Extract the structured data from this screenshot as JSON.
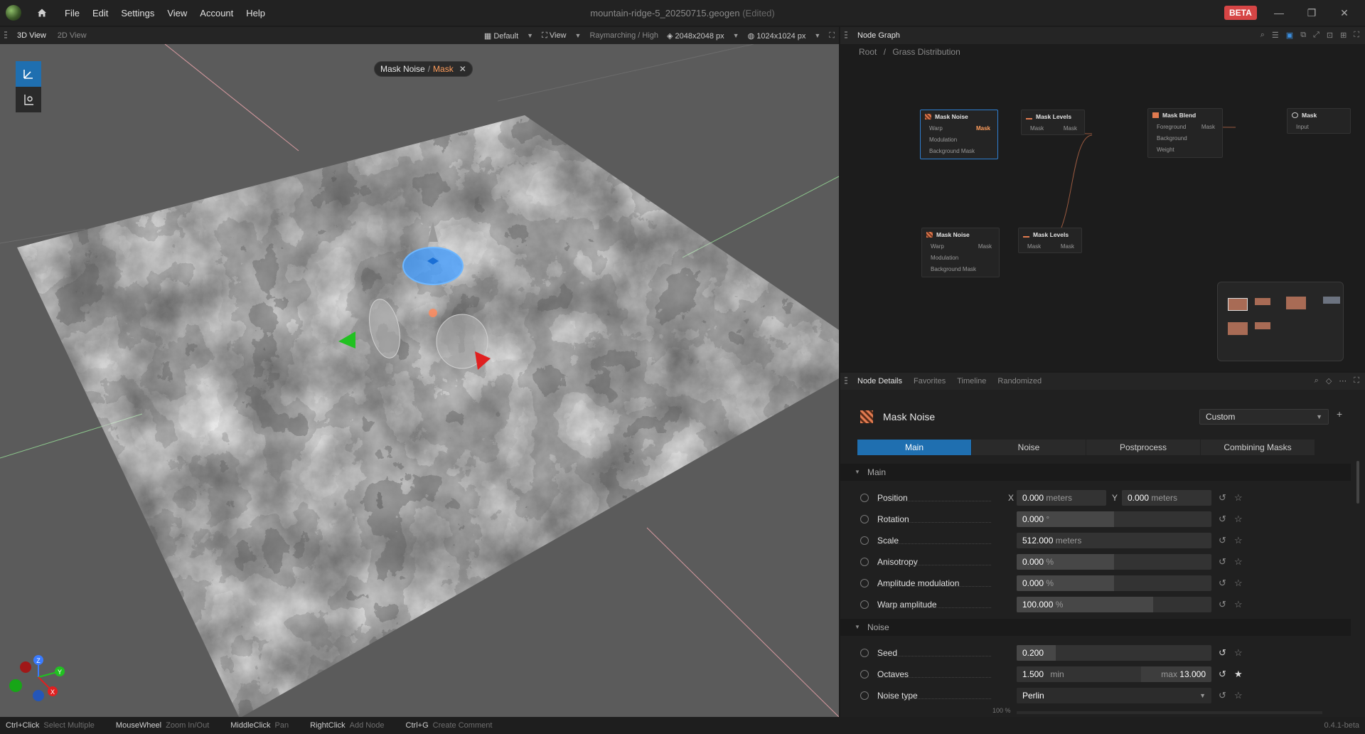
{
  "app": {
    "menu": [
      "File",
      "Edit",
      "Settings",
      "View",
      "Account",
      "Help"
    ],
    "title": "mountain-ridge-5_20250715.geogen",
    "title_status": "(Edited)",
    "badge": "BETA",
    "icons": {
      "logo": "globe-logo",
      "home": "home-icon",
      "minimize": "minimize-icon",
      "maximize": "restore-icon",
      "close": "close-icon"
    }
  },
  "viewport": {
    "tabs": [
      "3D View",
      "2D View"
    ],
    "toolbar": {
      "layout": "Default",
      "view": "View",
      "render_mode": "Raymarching / High",
      "resolution": "2048x2048 px",
      "preview_resolution": "1024x1024 px"
    },
    "breadcrumb": {
      "node": "Mask Noise",
      "separator": "/",
      "output": "Mask"
    },
    "axes": [
      "Z",
      "Y",
      "X"
    ]
  },
  "node_graph": {
    "panel_title": "Node Graph",
    "breadcrumb": [
      "Root",
      "Grass Distribution"
    ],
    "nodes": [
      {
        "title": "Mask Noise",
        "inputs": [
          "Warp",
          "Modulation",
          "Background Mask"
        ],
        "output": "Mask"
      },
      {
        "title": "Mask Levels",
        "inputs": [
          "Mask"
        ],
        "output": "Mask"
      },
      {
        "title": "Mask Blend",
        "inputs": [
          "Foreground",
          "Background",
          "Weight"
        ],
        "output": "Mask"
      },
      {
        "title": "Mask",
        "inputs": [
          "Input"
        ],
        "output": ""
      },
      {
        "title": "Mask Noise",
        "inputs": [
          "Warp",
          "Modulation",
          "Background Mask"
        ],
        "output": "Mask"
      },
      {
        "title": "Mask Levels",
        "inputs": [
          "Mask"
        ],
        "output": "Mask"
      }
    ]
  },
  "details": {
    "tabs": [
      "Node Details",
      "Favorites",
      "Timeline",
      "Randomized"
    ],
    "node_title": "Mask Noise",
    "preset": "Custom",
    "param_tabs": [
      "Main",
      "Noise",
      "Postprocess",
      "Combining Masks"
    ],
    "sections": {
      "main": "Main",
      "noise": "Noise"
    },
    "params": {
      "position": {
        "label": "Position",
        "x_label": "X",
        "x": "0.000",
        "y_label": "Y",
        "y": "0.000",
        "unit": "meters"
      },
      "rotation": {
        "label": "Rotation",
        "value": "0.000",
        "unit": "°",
        "fill": 0.5
      },
      "scale": {
        "label": "Scale",
        "value": "512.000",
        "unit": "meters",
        "fill": 0.0
      },
      "anisotropy": {
        "label": "Anisotropy",
        "value": "0.000",
        "unit": "%",
        "fill": 0.5
      },
      "amplitude_modulation": {
        "label": "Amplitude modulation",
        "value": "0.000",
        "unit": "%",
        "fill": 0.5
      },
      "warp_amplitude": {
        "label": "Warp amplitude",
        "value": "100.000",
        "unit": "%",
        "fill": 0.7
      },
      "seed": {
        "label": "Seed",
        "value": "0.200",
        "fill": 0.2
      },
      "octaves": {
        "label": "Octaves",
        "min_value": "1.500",
        "min_label": "min",
        "max_label": "max",
        "max_value": "13.000"
      },
      "noise_type": {
        "label": "Noise type",
        "value": "Perlin"
      },
      "partial": "100 %"
    }
  },
  "statusbar": [
    {
      "key": "Ctrl+Click",
      "action": "Select Multiple"
    },
    {
      "key": "MouseWheel",
      "action": "Zoom In/Out"
    },
    {
      "key": "MiddleClick",
      "action": "Pan"
    },
    {
      "key": "RightClick",
      "action": "Add Node"
    },
    {
      "key": "Ctrl+G",
      "action": "Create Comment"
    }
  ],
  "version": "0.4.1-beta"
}
